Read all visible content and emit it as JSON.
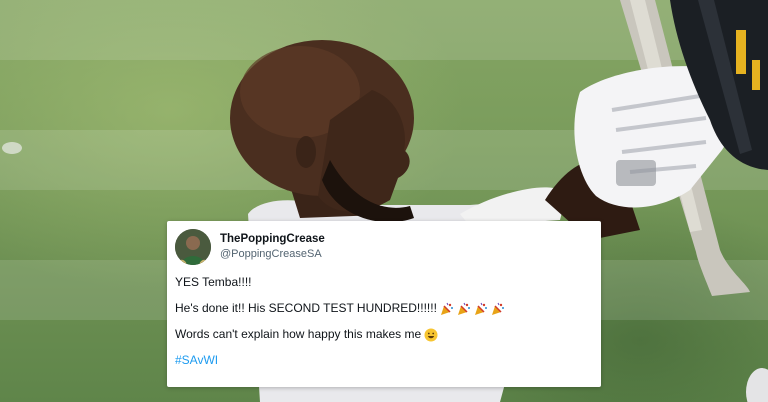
{
  "tweet": {
    "display_name": "ThePoppingCrease",
    "handle": "@PoppingCreaseSA",
    "line_1": "YES Temba!!!!",
    "line_2": "He's done it!! His SECOND TEST HUNDRED!!!!!!",
    "line_2_emojis": [
      "party-popper-icon",
      "party-popper-icon",
      "party-popper-icon",
      "party-popper-icon"
    ],
    "line_3": "Words can't explain how happy this makes me",
    "line_3_emoji": "smiley-face-icon",
    "hashtag": "#SAvWI"
  },
  "colors": {
    "grass": "#7a9c5c",
    "card_background": "#ffffff",
    "hashtag": "#1d9bf0",
    "handle": "#536471",
    "text": "#0f1419",
    "helmet_stripe": "#e6b220"
  }
}
